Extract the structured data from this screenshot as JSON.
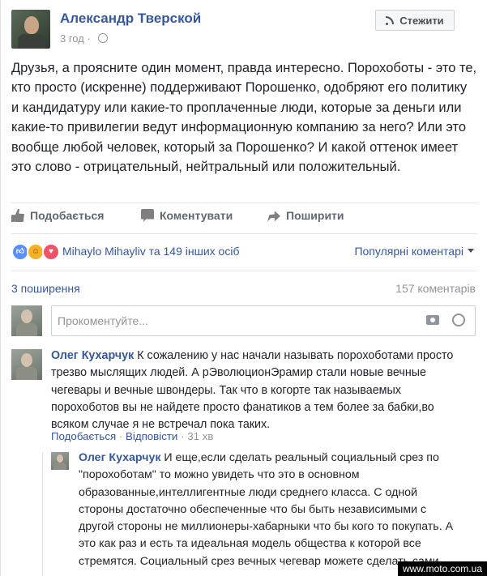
{
  "post": {
    "author": "Александр Тверской",
    "time": "3 год",
    "follow_label": "Стежити",
    "text": "Друзья, а проясните один момент, правда интересно. Порохоботы - это те, кто просто (искренне) поддерживают Порошенко, одобряют его политику и кандидатуру или какие-то проплаченные люди, которые за деньги или какие-то привилегии ведут информационную компанию за него? Или это вообще любой человек, который за Порошенко? И какой оттенок имеет это слово - отрицательный, нейтральный или положительный."
  },
  "actions": {
    "like": "Подобається",
    "comment": "Коментувати",
    "share": "Поширити"
  },
  "reactions": {
    "summary": "Mihaylo Mihayliv та 149 інших осіб",
    "sort_label": "Популярні коментарі"
  },
  "stats": {
    "shares": "3 поширення",
    "comments": "157 коментарів"
  },
  "composer": {
    "placeholder": "Прокоментуйте..."
  },
  "comments": [
    {
      "author": "Олег Кухарчук",
      "text": "К сожалению у нас начали называть порохоботами просто трезво мыслящих людей. А рЭволюционЭрамир стали новые вечные чегевары и вечные швондеры. Так что в когорте так называемых порохоботов вы не найдете просто фанатиков а тем более за бабки,во всяком случае я не встречал пока таких.",
      "like_label": "Подобається",
      "reply_label": "Відповісти",
      "time": "31 хв"
    }
  ],
  "reply": {
    "author": "Олег Кухарчук",
    "text": "И еще,если сделать реальный социальный срез по \"порохоботам\" то можно увидеть что это в основном образованные,интеллигентные люди среднего класса. С одной стороны достаточно обеспеченные что бы быть независимыми с другой стороны не миллионеры-хабарныки что бы кого то покупать. А это как раз и есть та идеальная модель общества к которой все стремятся. Социальный срез вечных чегевар можете сделать сами...."
  },
  "watermark": "www.moto.com.ua"
}
